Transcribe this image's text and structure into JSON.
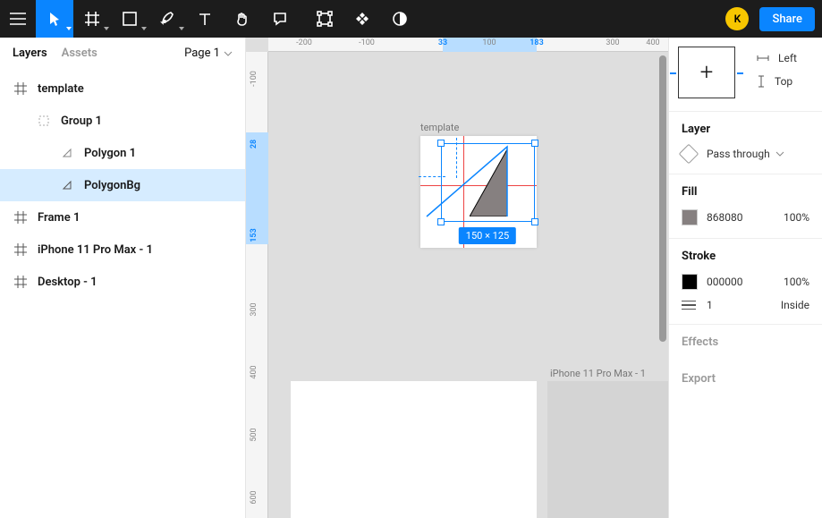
{
  "topbar": {
    "avatar_initial": "K",
    "share_label": "Share"
  },
  "left": {
    "tab_layers": "Layers",
    "tab_assets": "Assets",
    "page_label": "Page 1",
    "tree": {
      "template": "template",
      "group1": "Group 1",
      "polygon1": "Polygon 1",
      "polygonbg": "PolygonBg",
      "frame1": "Frame 1",
      "iphone": "iPhone 11 Pro Max - 1",
      "desktop": "Desktop - 1"
    }
  },
  "canvas": {
    "ruler_h": {
      "neg200": "-200",
      "neg100": "-100",
      "n33": "33",
      "n100": "100",
      "n183": "183",
      "n300": "300",
      "n400": "400"
    },
    "ruler_v": {
      "neg100": "-100",
      "n28": "28",
      "n153": "153",
      "n300": "300",
      "n400": "400",
      "n500": "500",
      "n600": "600"
    },
    "frame_template_label": "template",
    "frame_iphone_label": "iPhone 11 Pro Max - 1",
    "selection_dims": "150 × 125"
  },
  "right": {
    "align_left": "Left",
    "align_top": "Top",
    "layer_title": "Layer",
    "blend_mode": "Pass through",
    "fill_title": "Fill",
    "fill_hex": "868080",
    "fill_pct": "100%",
    "stroke_title": "Stroke",
    "stroke_hex": "000000",
    "stroke_pct": "100%",
    "stroke_width": "1",
    "stroke_pos": "Inside",
    "effects_title": "Effects",
    "export_title": "Export"
  }
}
